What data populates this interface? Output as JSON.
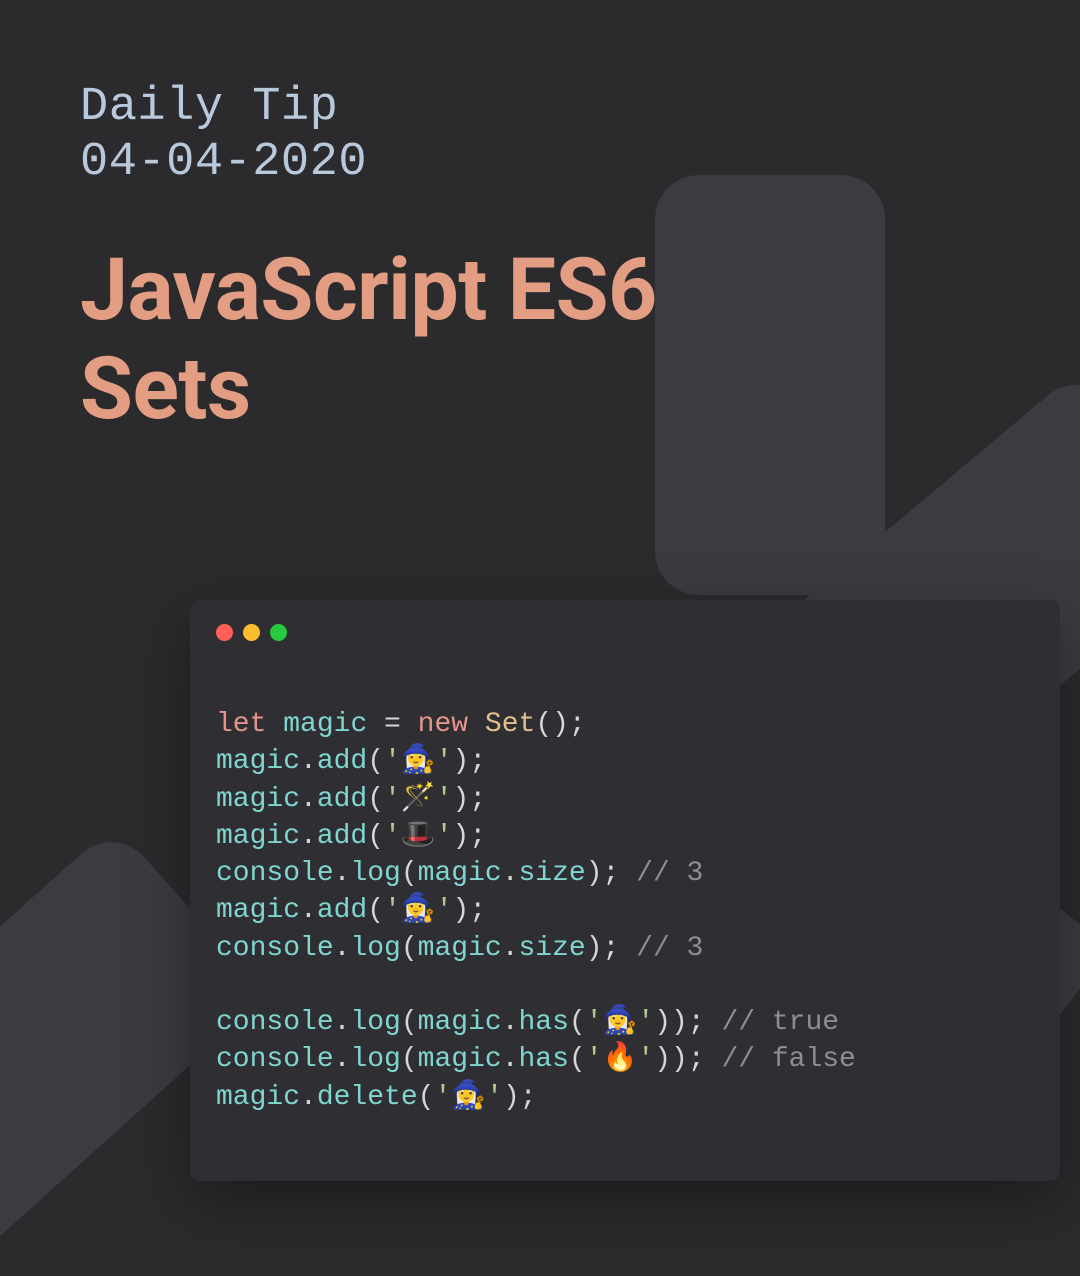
{
  "header": {
    "eyebrow_line1": "Daily Tip",
    "eyebrow_line2": "04-04-2020",
    "headline_line1": "JavaScript ES6",
    "headline_line2": "Sets"
  },
  "window": {
    "dots": {
      "close": "#ff5f56",
      "min": "#ffbd2e",
      "max": "#27c93f"
    }
  },
  "code": {
    "let": "let",
    "ident": "magic",
    "eq": " = ",
    "new": "new",
    "Set": " Set",
    "paren": "();",
    "dot": ".",
    "add": "add",
    "open": "(",
    "close": ");",
    "closeParen": ")",
    "log": "log",
    "size": "size",
    "has": "has",
    "delete": "delete",
    "console": "console",
    "semi": ";",
    "sp": " ",
    "str_mage": "'🧙‍♀️'",
    "str_wand": "'🪄'",
    "str_tophat": "'🎩'",
    "str_fire": "'🔥'",
    "c3a": "// 3",
    "c3b": "// 3",
    "ctrue": "// true",
    "cfalse": "// false"
  }
}
